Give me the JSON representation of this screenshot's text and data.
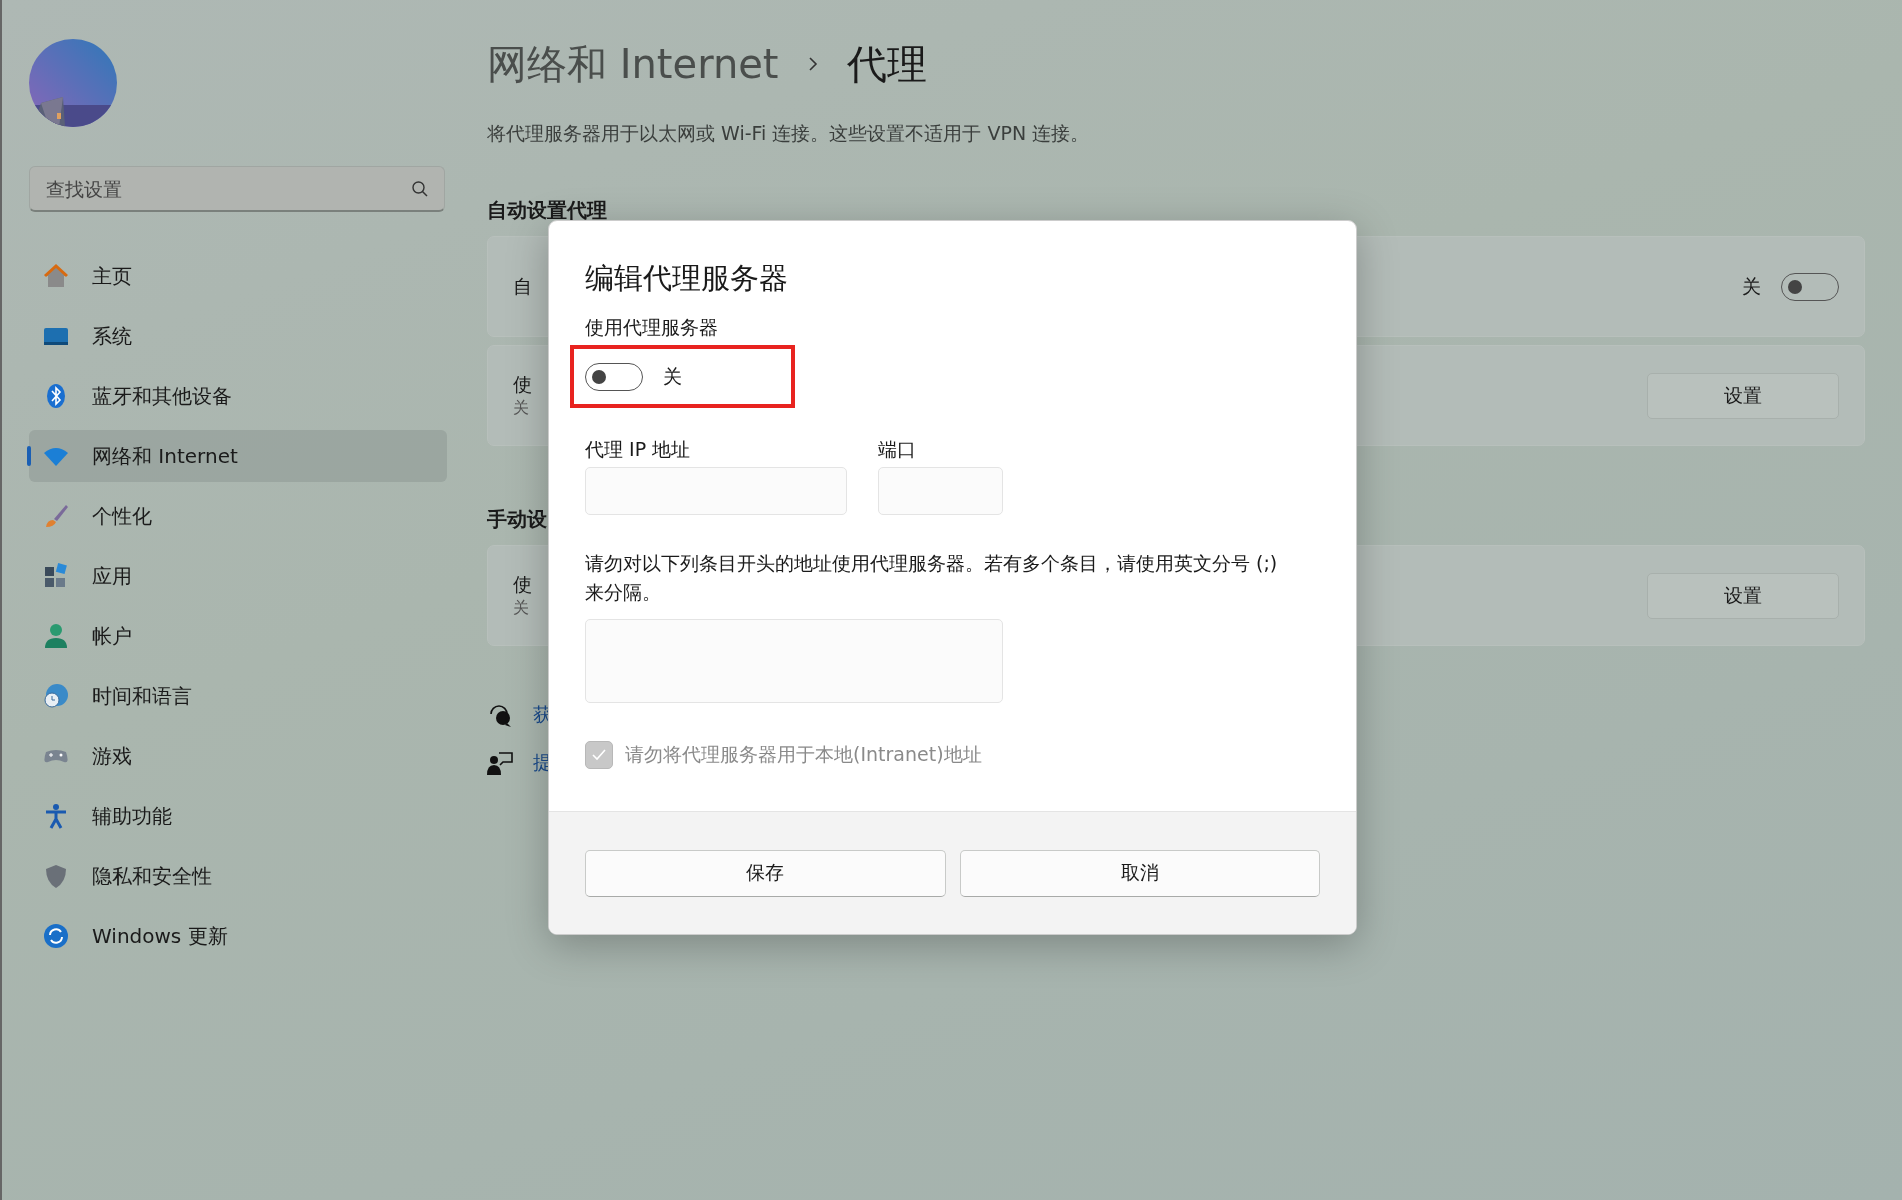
{
  "sidebar": {
    "search": {
      "placeholder": "查找设置"
    },
    "items": [
      {
        "label": "主页",
        "kind": "home",
        "selected": false
      },
      {
        "label": "系统",
        "kind": "system",
        "selected": false
      },
      {
        "label": "蓝牙和其他设备",
        "kind": "bluetooth",
        "selected": false
      },
      {
        "label": "网络和 Internet",
        "kind": "wifi",
        "selected": true
      },
      {
        "label": "个性化",
        "kind": "brush",
        "selected": false
      },
      {
        "label": "应用",
        "kind": "apps",
        "selected": false
      },
      {
        "label": "帐户",
        "kind": "person",
        "selected": false
      },
      {
        "label": "时间和语言",
        "kind": "clock",
        "selected": false
      },
      {
        "label": "游戏",
        "kind": "gamepad",
        "selected": false
      },
      {
        "label": "辅助功能",
        "kind": "accessibility",
        "selected": false
      },
      {
        "label": "隐私和安全性",
        "kind": "shield",
        "selected": false
      },
      {
        "label": "Windows 更新",
        "kind": "update",
        "selected": false
      }
    ]
  },
  "header": {
    "breadcrumb": [
      "网络和 Internet",
      "代理"
    ],
    "description": "将代理服务器用于以太网或 Wi-Fi 连接。这些设置不适用于 VPN 连接。"
  },
  "sections": [
    {
      "heading": "自动设置代理",
      "cards": [
        {
          "title": "自",
          "control": {
            "kind": "toggle",
            "label": "关",
            "on": false
          }
        },
        {
          "title": "使",
          "subtitle": "关",
          "control": {
            "kind": "button",
            "label": "设置"
          }
        }
      ]
    },
    {
      "heading": "手动设",
      "cards": [
        {
          "title": "使",
          "subtitle": "关",
          "control": {
            "kind": "button",
            "label": "设置"
          }
        }
      ]
    }
  ],
  "links": [
    {
      "kind": "help",
      "label": "获"
    },
    {
      "kind": "feedback",
      "label": "提"
    }
  ],
  "dialog": {
    "title": "编辑代理服务器",
    "use_proxy": {
      "label": "使用代理服务器",
      "on": false,
      "state_text": "关",
      "highlighted": true
    },
    "ip_field": {
      "label": "代理 IP 地址"
    },
    "port_field": {
      "label": "端口"
    },
    "exceptions": {
      "description": "请勿对以下列条目开头的地址使用代理服务器。若有多个条目，请使用英文分号 (;) 来分隔。"
    },
    "local_checkbox": {
      "label": "请勿将代理服务器用于本地(Intranet)地址",
      "checked": true,
      "disabled": true
    },
    "buttons": [
      {
        "label": "保存"
      },
      {
        "label": "取消"
      }
    ]
  }
}
